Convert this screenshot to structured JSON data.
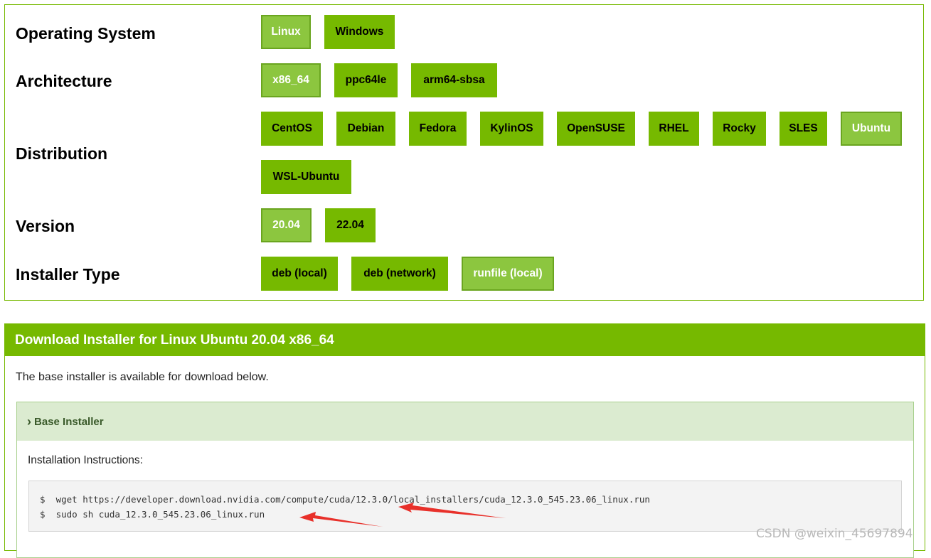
{
  "selector": {
    "os": {
      "label": "Operating System",
      "options": [
        "Linux",
        "Windows"
      ],
      "selected": "Linux"
    },
    "arch": {
      "label": "Architecture",
      "options": [
        "x86_64",
        "ppc64le",
        "arm64-sbsa"
      ],
      "selected": "x86_64"
    },
    "distro": {
      "label": "Distribution",
      "options": [
        "CentOS",
        "Debian",
        "Fedora",
        "KylinOS",
        "OpenSUSE",
        "RHEL",
        "Rocky",
        "SLES",
        "Ubuntu",
        "WSL-Ubuntu"
      ],
      "selected": "Ubuntu"
    },
    "version": {
      "label": "Version",
      "options": [
        "20.04",
        "22.04"
      ],
      "selected": "20.04"
    },
    "installer": {
      "label": "Installer Type",
      "options": [
        "deb (local)",
        "deb (network)",
        "runfile (local)"
      ],
      "selected": "runfile (local)"
    }
  },
  "download": {
    "header": "Download Installer for Linux Ubuntu 20.04 x86_64",
    "description": "The base installer is available for download below.",
    "base_installer": {
      "title": "Base Installer",
      "instructions_label": "Installation Instructions:",
      "commands": [
        {
          "prompt": "$",
          "text": "wget https://developer.download.nvidia.com/compute/cuda/12.3.0/local_installers/cuda_12.3.0_545.23.06_linux.run"
        },
        {
          "prompt": "$",
          "text": "sudo sh cuda_12.3.0_545.23.06_linux.run"
        }
      ]
    }
  },
  "watermark": "CSDN @weixin_45697894",
  "colors": {
    "accent": "#76b900",
    "selected": "#8cc63f",
    "annotation_arrow": "#e8302a"
  }
}
